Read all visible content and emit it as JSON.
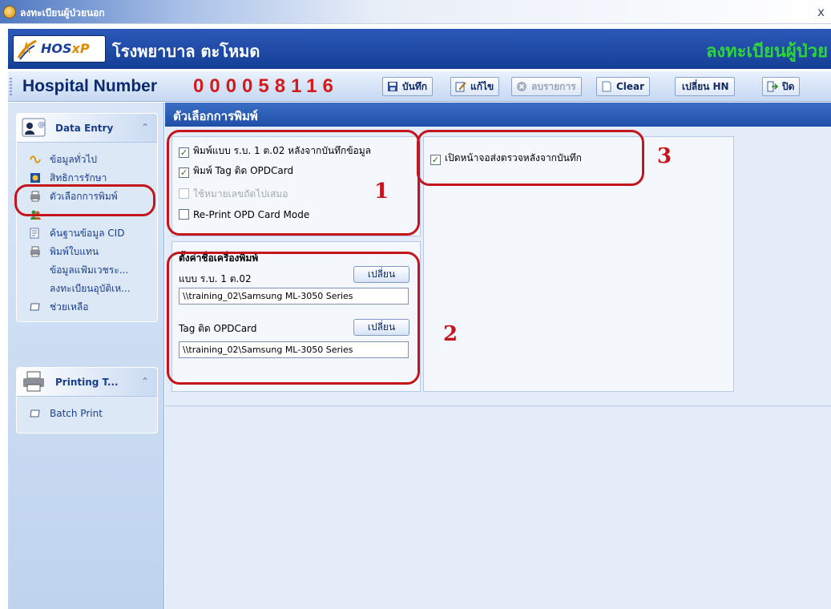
{
  "window": {
    "title": "ลงทะเบียนผู้ป่วยนอก",
    "close_glyph": "x"
  },
  "banner": {
    "logo_text": "HOS",
    "logo_suffix": "xP",
    "hospital_name": "โรงพยาบาล ตะโหมด",
    "module_name": "ลงทะเบียนผู้ป่วย"
  },
  "toolbar": {
    "hn_label": "Hospital Number",
    "hn_value": "000058116",
    "buttons": {
      "save": "บันทึก",
      "edit": "แก้ไข",
      "delete": "ลบรายการ",
      "clear": "Clear",
      "change_hn": "เปลี่ยน HN",
      "close": "ปิด"
    }
  },
  "sidebar": {
    "data_entry": {
      "title": "Data Entry",
      "items": [
        "ข้อมูลทั่วไป",
        "สิทธิการรักษา",
        "ตัวเลือกการพิมพ์",
        "---",
        "ค้นฐานข้อมูล CID",
        "พิมพ์ใบแทน",
        "ข้อมูลแฟ้มเวชระ...",
        "ลงทะเบียนอุบัติเห...",
        "ช่วยเหลือ"
      ]
    },
    "printing": {
      "title": "Printing T...",
      "items": [
        "Batch Print"
      ]
    }
  },
  "content": {
    "title": "ตัวเลือกการพิมพ์",
    "options": [
      {
        "label": "พิมพ์แบบ ร.บ. 1 ต.02 หลังจากบันทึกข้อมูล",
        "checked": true,
        "enabled": true
      },
      {
        "label": "พิมพ์ Tag ติด OPDCard",
        "checked": true,
        "enabled": true
      },
      {
        "label": "ใช้หมายเลขถัดไปเสมอ",
        "checked": false,
        "enabled": false
      },
      {
        "label": "Re-Print OPD Card Mode",
        "checked": false,
        "enabled": true
      }
    ],
    "printer_group_title": "ตั้งค่าชื่อเครื่องพิมพ์",
    "printer1_label": "แบบ ร.บ. 1 ต.02",
    "printer1_value": "\\\\training_02\\Samsung ML-3050 Series",
    "printer2_label": "Tag ติด OPDCard",
    "printer2_value": "\\\\training_02\\Samsung ML-3050 Series",
    "change_label": "เปลี่ยน",
    "right_option": {
      "label": "เปิดหน้าจอส่งตรวจหลังจากบันทึก",
      "checked": true
    }
  },
  "annotations": {
    "n1": "1",
    "n2": "2",
    "n3": "3"
  },
  "colors": {
    "accent_red": "#c4141c",
    "hn_red": "#d21c1c",
    "module_green": "#2fd43c",
    "header_blue": "#1f4ea6"
  }
}
